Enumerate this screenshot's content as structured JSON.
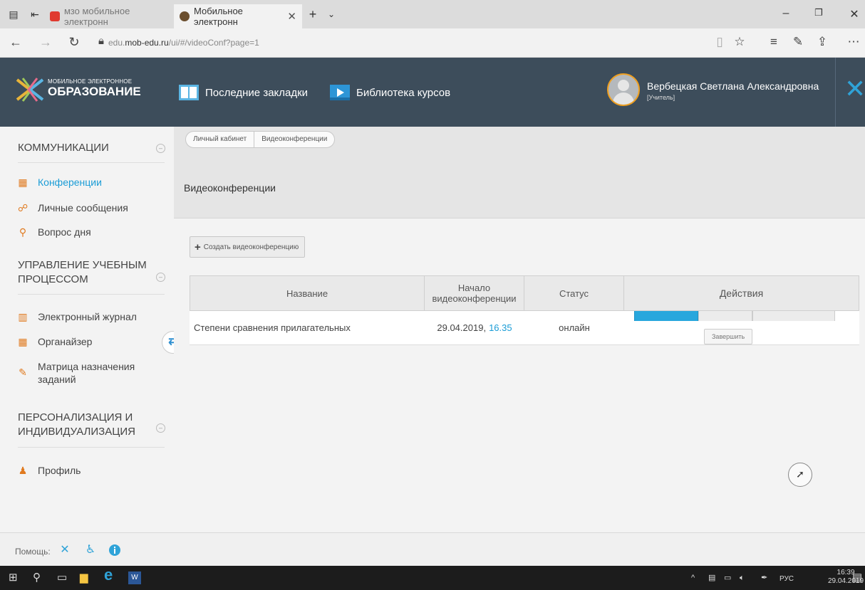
{
  "browser": {
    "tabs": [
      {
        "label": "мзо мобильное электронн",
        "active": false
      },
      {
        "label": "Мобильное электронн",
        "active": true
      }
    ],
    "url_prefix": "edu.",
    "url_domain": "mob-edu.ru",
    "url_path": "/ui/#/videoConf?page=1"
  },
  "header": {
    "logo_small": "МОБИЛЬНОЕ ЭЛЕКТРОННОЕ",
    "logo_big": "ОБРАЗОВАНИЕ",
    "bookmarks_label": "Последние закладки",
    "library_label": "Библиотека курсов",
    "user_name": "Вербецкая Светлана Александровна",
    "user_role": "[Учитель]"
  },
  "sidebar": {
    "sections": [
      {
        "title": "КОММУНИКАЦИИ",
        "items": [
          "Конференции",
          "Личные сообщения",
          "Вопрос дня"
        ]
      },
      {
        "title_line1": "УПРАВЛЕНИЕ УЧЕБНЫМ",
        "title_line2": "ПРОЦЕССОМ",
        "items": [
          "Электронный журнал",
          "Органайзер",
          "Матрица назначения",
          "заданий"
        ]
      },
      {
        "title_line1": "ПЕРСОНАЛИЗАЦИЯ И",
        "title_line2": "ИНДИВИДУАЛИЗАЦИЯ",
        "items": [
          "Профиль"
        ]
      }
    ]
  },
  "breadcrumb": [
    "Личный кабинет",
    "Видеоконференции"
  ],
  "page_title": "Видеоконференции",
  "create_button": "Создать видеоконференцию",
  "table": {
    "headers": [
      "Название",
      "Начало",
      "видеоконференции",
      "Статус",
      "Действия"
    ],
    "row": {
      "name": "Степени сравнения прилагательных",
      "date": "29.04.2019,",
      "time": "16.35",
      "status": "онлайн",
      "finish": "Завершить"
    }
  },
  "help_label": "Помощь:",
  "taskbar": {
    "lang": "РУС",
    "time": "16:39",
    "date": "29.04.2019"
  }
}
